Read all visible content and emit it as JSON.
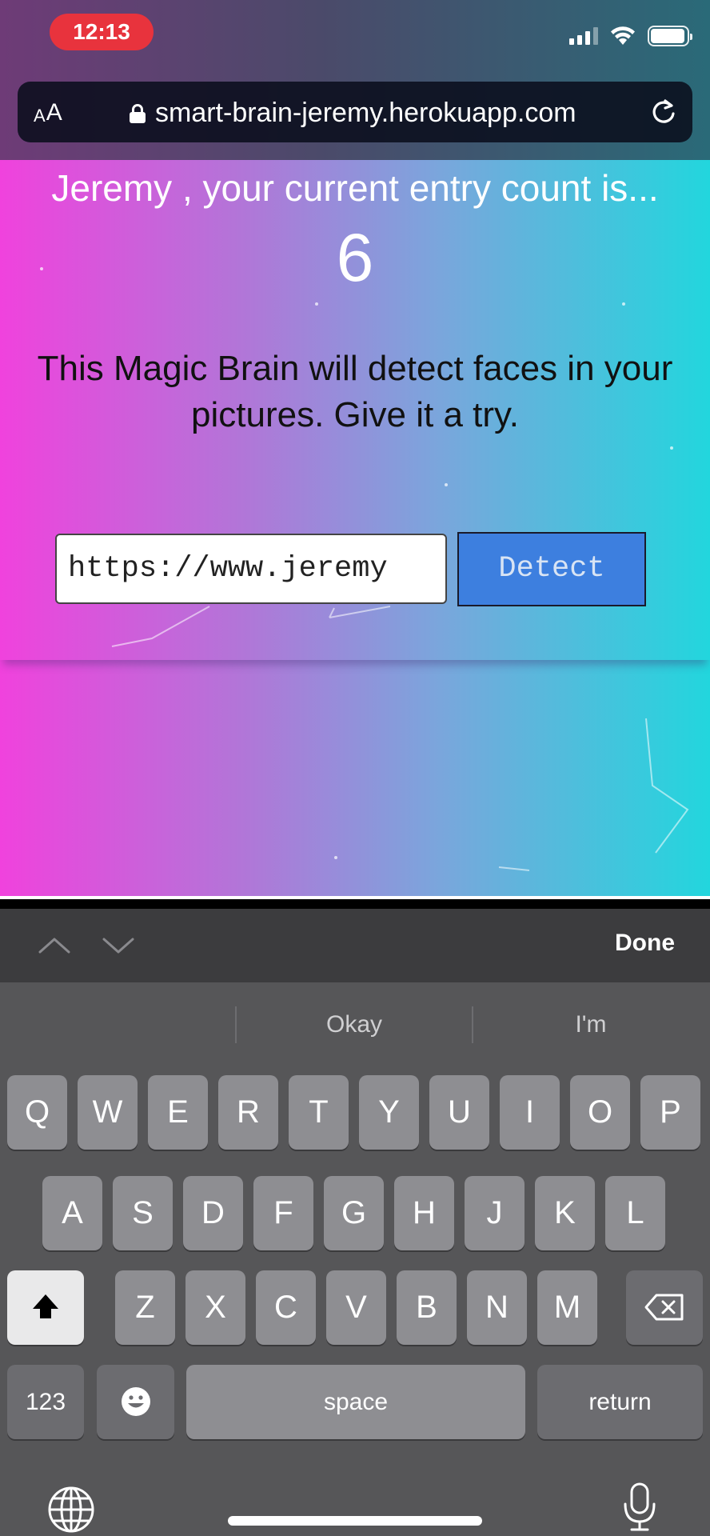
{
  "status_bar": {
    "time": "12:13",
    "signal_bars_filled": 3,
    "signal_bars_total": 4,
    "battery_level": 0.95
  },
  "browser": {
    "text_size_button": {
      "small_a": "A",
      "large_a": "A"
    },
    "url": "smart-brain-jeremy.herokuapp.com",
    "icons": [
      "lock-icon",
      "reload-icon"
    ]
  },
  "page": {
    "rank_line": "Jeremy , your current entry count is...",
    "rank_count": "6",
    "intro_text": "This Magic Brain will detect faces in your pictures. Give it a try.",
    "image_url_input_value": "https://www.jeremy",
    "detect_button": "Detect",
    "colors": {
      "gradient_start": "#f042dd",
      "gradient_end": "#22d6dd",
      "detect_button_bg": "#3d7fdf"
    }
  },
  "keyboard": {
    "accessory": {
      "prev_icon": "chevron-up-icon",
      "next_icon": "chevron-down-icon",
      "done_label": "Done"
    },
    "predictions": [
      "",
      "Okay",
      "I'm"
    ],
    "rows": [
      [
        "Q",
        "W",
        "E",
        "R",
        "T",
        "Y",
        "U",
        "I",
        "O",
        "P"
      ],
      [
        "A",
        "S",
        "D",
        "F",
        "G",
        "H",
        "J",
        "K",
        "L"
      ],
      [
        "Z",
        "X",
        "C",
        "V",
        "B",
        "N",
        "M"
      ]
    ],
    "numbers_key": "123",
    "space_key": "space",
    "return_key": "return",
    "icons": [
      "shift-icon",
      "backspace-icon",
      "emoji-icon",
      "globe-icon",
      "microphone-icon"
    ]
  }
}
